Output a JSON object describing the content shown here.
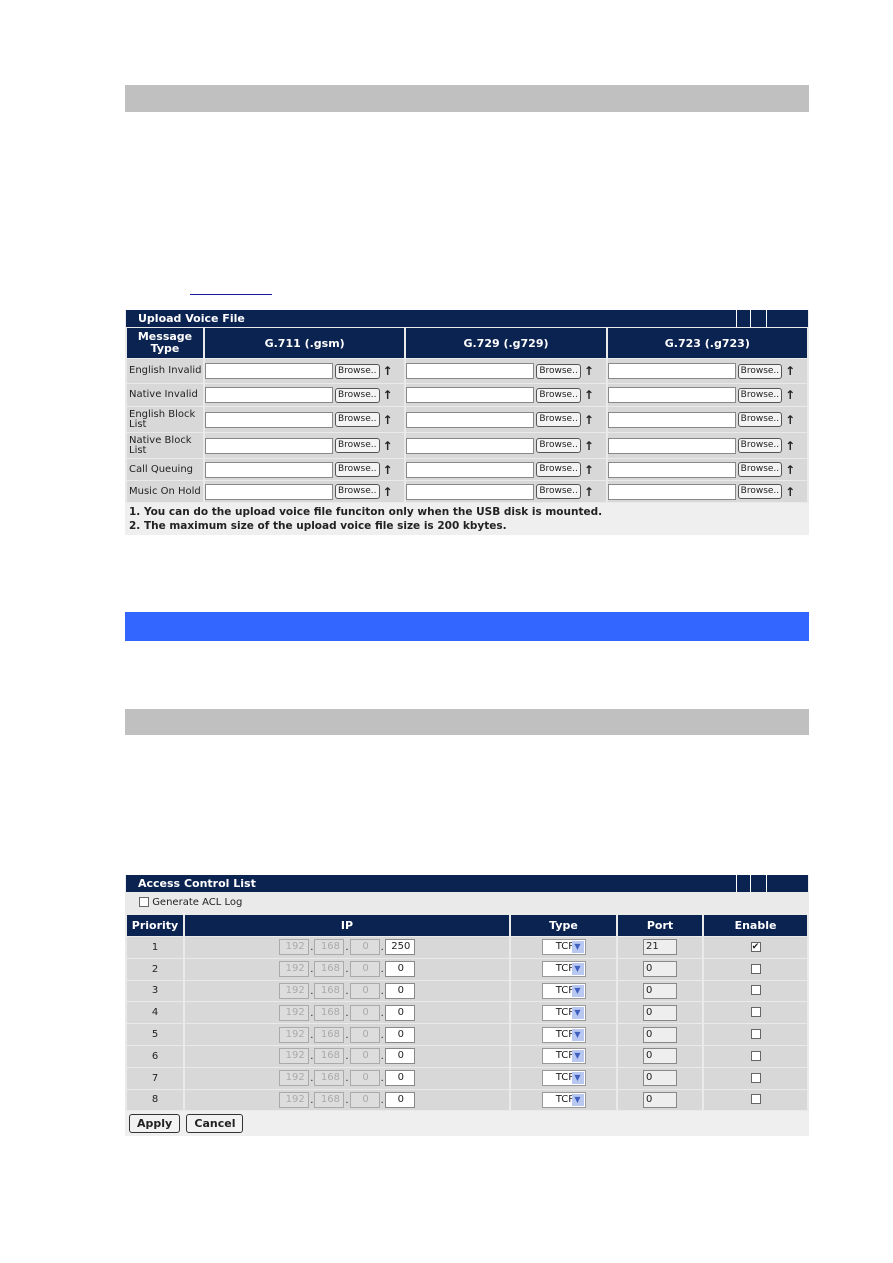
{
  "upload": {
    "title": "Upload Voice File",
    "headers": [
      "Message Type",
      "G.711 (.gsm)",
      "G.729 (.g729)",
      "G.723 (.g723)"
    ],
    "rows": [
      "English Invalid",
      "Native Invalid",
      "English Block List",
      "Native Block List",
      "Call Queuing",
      "Music On Hold"
    ],
    "browse_label": "Browse..",
    "upload_icon": "up-arrow-icon",
    "notes": [
      "1. You can do the upload voice file funciton only when the USB disk is mounted.",
      "2. The maximum size of the upload voice file size is 200 kbytes."
    ]
  },
  "acl": {
    "title": "Access Control List",
    "generate_log_label": "Generate ACL Log",
    "generate_log_checked": false,
    "headers": [
      "Priority",
      "IP",
      "Type",
      "Port",
      "Enable"
    ],
    "rows": [
      {
        "priority": "1",
        "ip": [
          "192",
          "168",
          "0",
          "250"
        ],
        "type": "TCP",
        "port": "21",
        "enabled": true
      },
      {
        "priority": "2",
        "ip": [
          "192",
          "168",
          "0",
          "0"
        ],
        "type": "TCP",
        "port": "0",
        "enabled": false
      },
      {
        "priority": "3",
        "ip": [
          "192",
          "168",
          "0",
          "0"
        ],
        "type": "TCP",
        "port": "0",
        "enabled": false
      },
      {
        "priority": "4",
        "ip": [
          "192",
          "168",
          "0",
          "0"
        ],
        "type": "TCP",
        "port": "0",
        "enabled": false
      },
      {
        "priority": "5",
        "ip": [
          "192",
          "168",
          "0",
          "0"
        ],
        "type": "TCP",
        "port": "0",
        "enabled": false
      },
      {
        "priority": "6",
        "ip": [
          "192",
          "168",
          "0",
          "0"
        ],
        "type": "TCP",
        "port": "0",
        "enabled": false
      },
      {
        "priority": "7",
        "ip": [
          "192",
          "168",
          "0",
          "0"
        ],
        "type": "TCP",
        "port": "0",
        "enabled": false
      },
      {
        "priority": "8",
        "ip": [
          "192",
          "168",
          "0",
          "0"
        ],
        "type": "TCP",
        "port": "0",
        "enabled": false
      }
    ],
    "apply_label": "Apply",
    "cancel_label": "Cancel"
  },
  "colors": {
    "header_navy": "#0b2350",
    "section_blue": "#3366ff",
    "section_gray": "#c0c0c0"
  }
}
